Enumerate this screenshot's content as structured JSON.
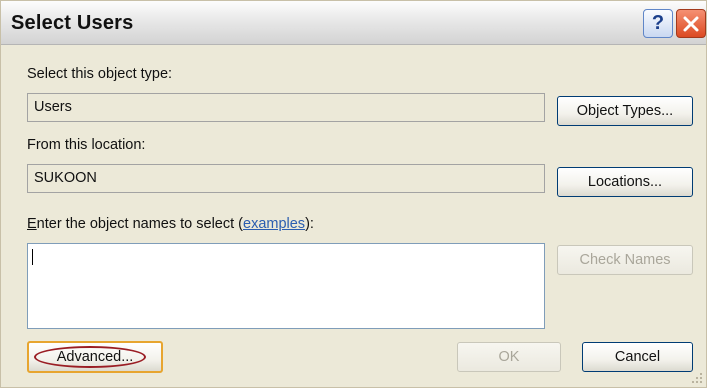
{
  "window": {
    "title": "Select Users",
    "help_label": "?"
  },
  "object_type": {
    "label": "Select this object type:",
    "value": "Users",
    "button_label": "Object Types..."
  },
  "location": {
    "label": "From this location:",
    "value": "SUKOON",
    "button_label": "Locations..."
  },
  "object_names": {
    "label_mnemonic": "E",
    "label_before_link": "nter the object names to select (",
    "link_text": "examples",
    "label_after_link": "):",
    "value": "",
    "check_names_label": "Check Names"
  },
  "footer": {
    "advanced_label": "Advanced...",
    "ok_label": "OK",
    "cancel_label": "Cancel"
  },
  "colors": {
    "dialog_bg": "#ece9d8",
    "highlight_ellipse": "#9a1d24",
    "link": "#2a5db0",
    "close_button": "#dc4a22"
  }
}
